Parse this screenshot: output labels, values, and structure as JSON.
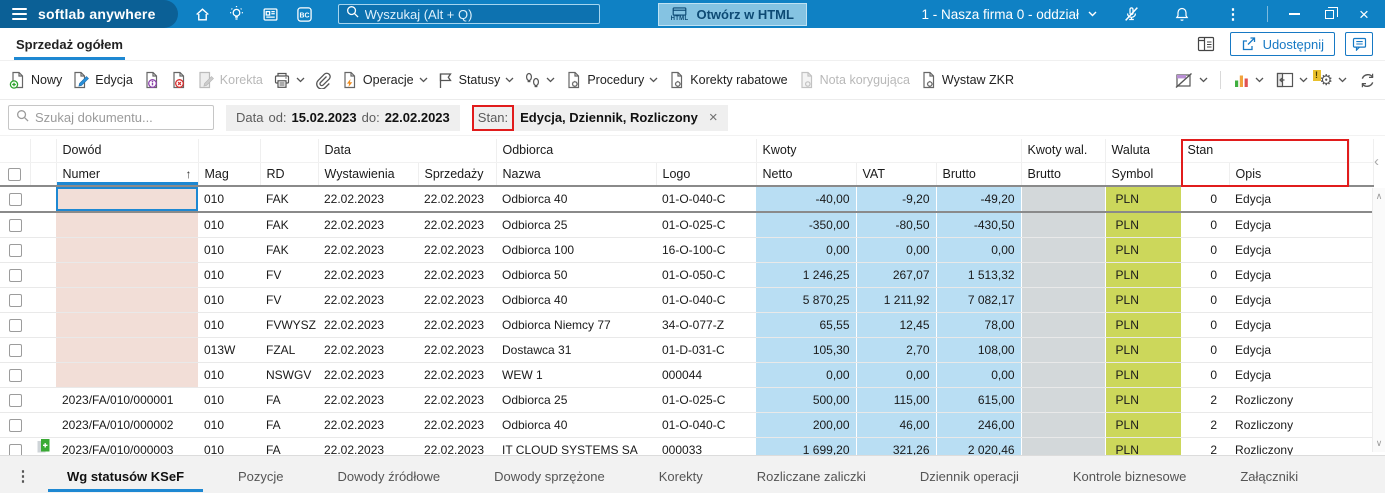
{
  "colors": {
    "topbar_blue": "#0f81c4",
    "logo_blue": "#0b6096",
    "accent_blue": "#1779c4",
    "tab_underline": "#1e88d2",
    "cell_blue": "#b9def3",
    "cell_gray": "#d3d8da",
    "cell_green": "#ccd75b",
    "cell_pink": "#f2ded7",
    "annotation_red": "#e11c1c"
  },
  "icons": {
    "bc_text": "BC",
    "html_text": "HTML",
    "kebab": "⋮",
    "window_close": "×",
    "sort_asc": "↑",
    "chip_close": "×",
    "collapse_left": "‹",
    "scroll_up": "∧",
    "scroll_down": "∨",
    "gear": "⚙",
    "warn": "!"
  },
  "topbar": {
    "logo": "softlab anywhere",
    "search_placeholder": "Wyszukaj (Alt + Q)",
    "open_html": "Otwórz w HTML",
    "company": "1 - Nasza firma 0 - oddział"
  },
  "page": {
    "tab": "Sprzedaż ogółem",
    "share": "Udostępnij"
  },
  "toolbar": {
    "nowy": "Nowy",
    "edycja": "Edycja",
    "korekta": "Korekta",
    "operacje": "Operacje",
    "statusy": "Statusy",
    "procedury": "Procedury",
    "korekty_rabatowe": "Korekty rabatowe",
    "nota": "Nota korygująca",
    "zkr": "Wystaw ZKR"
  },
  "filters": {
    "search_placeholder": "Szukaj dokumentu...",
    "data_label": "Data",
    "od_label": "od:",
    "od_value": "15.02.2023",
    "do_label": "do:",
    "do_value": "22.02.2023",
    "stan_label": "Stan:",
    "stan_value": "Edycja, Dziennik, Rozliczony"
  },
  "table": {
    "groups": {
      "dowod": "Dowód",
      "data": "Data",
      "odbiorca": "Odbiorca",
      "kwoty": "Kwoty",
      "kwoty_wal": "Kwoty wal.",
      "waluta": "Waluta",
      "stan": "Stan"
    },
    "cols": {
      "numer": "Numer",
      "mag": "Mag",
      "rd": "RD",
      "wystawienia": "Wystawienia",
      "sprzedazy": "Sprzedaży",
      "nazwa": "Nazwa",
      "logo": "Logo",
      "netto": "Netto",
      "vat": "VAT",
      "brutto": "Brutto",
      "brutto_wal": "Brutto",
      "symbol": "Symbol",
      "opis": "Opis"
    },
    "rows": [
      {
        "numer": "",
        "mag": "010",
        "rd": "FAK",
        "wystawienia": "22.02.2023",
        "sprzedazy": "22.02.2023",
        "nazwa": "Odbiorca 40",
        "logo": "01-O-040-C",
        "netto": "-40,00",
        "vat": "-9,20",
        "brutto": "-49,20",
        "brutto_wal": "",
        "symbol": "PLN",
        "stan": "0",
        "opis": "Edycja",
        "focused": true,
        "current": true
      },
      {
        "numer": "",
        "mag": "010",
        "rd": "FAK",
        "wystawienia": "22.02.2023",
        "sprzedazy": "22.02.2023",
        "nazwa": "Odbiorca 25",
        "logo": "01-O-025-C",
        "netto": "-350,00",
        "vat": "-80,50",
        "brutto": "-430,50",
        "brutto_wal": "",
        "symbol": "PLN",
        "stan": "0",
        "opis": "Edycja"
      },
      {
        "numer": "",
        "mag": "010",
        "rd": "FAK",
        "wystawienia": "22.02.2023",
        "sprzedazy": "22.02.2023",
        "nazwa": "Odbiorca 100",
        "logo": "16-O-100-C",
        "netto": "0,00",
        "vat": "0,00",
        "brutto": "0,00",
        "brutto_wal": "",
        "symbol": "PLN",
        "stan": "0",
        "opis": "Edycja"
      },
      {
        "numer": "",
        "mag": "010",
        "rd": "FV",
        "wystawienia": "22.02.2023",
        "sprzedazy": "22.02.2023",
        "nazwa": "Odbiorca 50",
        "logo": "01-O-050-C",
        "netto": "1 246,25",
        "vat": "267,07",
        "brutto": "1 513,32",
        "brutto_wal": "",
        "symbol": "PLN",
        "stan": "0",
        "opis": "Edycja"
      },
      {
        "numer": "",
        "mag": "010",
        "rd": "FV",
        "wystawienia": "22.02.2023",
        "sprzedazy": "22.02.2023",
        "nazwa": "Odbiorca 40",
        "logo": "01-O-040-C",
        "netto": "5 870,25",
        "vat": "1 211,92",
        "brutto": "7 082,17",
        "brutto_wal": "",
        "symbol": "PLN",
        "stan": "0",
        "opis": "Edycja"
      },
      {
        "numer": "",
        "mag": "010",
        "rd": "FVWYSZ",
        "wystawienia": "22.02.2023",
        "sprzedazy": "22.02.2023",
        "nazwa": "Odbiorca Niemcy 77",
        "logo": "34-O-077-Z",
        "netto": "65,55",
        "vat": "12,45",
        "brutto": "78,00",
        "brutto_wal": "",
        "symbol": "PLN",
        "stan": "0",
        "opis": "Edycja"
      },
      {
        "numer": "",
        "mag": "013W",
        "rd": "FZAL",
        "wystawienia": "22.02.2023",
        "sprzedazy": "22.02.2023",
        "nazwa": "Dostawca 31",
        "logo": "01-D-031-C",
        "netto": "105,30",
        "vat": "2,70",
        "brutto": "108,00",
        "brutto_wal": "",
        "symbol": "PLN",
        "stan": "0",
        "opis": "Edycja"
      },
      {
        "numer": "",
        "mag": "010",
        "rd": "NSWGV",
        "wystawienia": "22.02.2023",
        "sprzedazy": "22.02.2023",
        "nazwa": "WEW 1",
        "logo": "000044",
        "netto": "0,00",
        "vat": "0,00",
        "brutto": "0,00",
        "brutto_wal": "",
        "symbol": "PLN",
        "stan": "0",
        "opis": "Edycja"
      },
      {
        "numer": "2023/FA/010/000001",
        "mag": "010",
        "rd": "FA",
        "wystawienia": "22.02.2023",
        "sprzedazy": "22.02.2023",
        "nazwa": "Odbiorca 25",
        "logo": "01-O-025-C",
        "netto": "500,00",
        "vat": "115,00",
        "brutto": "615,00",
        "brutto_wal": "",
        "symbol": "PLN",
        "stan": "2",
        "opis": "Rozliczony"
      },
      {
        "numer": "2023/FA/010/000002",
        "mag": "010",
        "rd": "FA",
        "wystawienia": "22.02.2023",
        "sprzedazy": "22.02.2023",
        "nazwa": "Odbiorca 40",
        "logo": "01-O-040-C",
        "netto": "200,00",
        "vat": "46,00",
        "brutto": "246,00",
        "brutto_wal": "",
        "symbol": "PLN",
        "stan": "2",
        "opis": "Rozliczony"
      },
      {
        "numer": "2023/FA/010/000003",
        "mag": "010",
        "rd": "FA",
        "wystawienia": "22.02.2023",
        "sprzedazy": "22.02.2023",
        "nazwa": "IT CLOUD SYSTEMS SA",
        "logo": "000033",
        "netto": "1 699,20",
        "vat": "321,26",
        "brutto": "2 020,46",
        "brutto_wal": "",
        "symbol": "PLN",
        "stan": "2",
        "opis": "Rozliczony",
        "icon": "ksef-sent"
      }
    ]
  },
  "footer_tabs": [
    {
      "label": "Wg statusów KSeF",
      "active": true
    },
    {
      "label": "Pozycje"
    },
    {
      "label": "Dowody źródłowe"
    },
    {
      "label": "Dowody sprzężone"
    },
    {
      "label": "Korekty"
    },
    {
      "label": "Rozliczane zaliczki"
    },
    {
      "label": "Dziennik operacji"
    },
    {
      "label": "Kontrole biznesowe"
    },
    {
      "label": "Załączniki"
    }
  ]
}
